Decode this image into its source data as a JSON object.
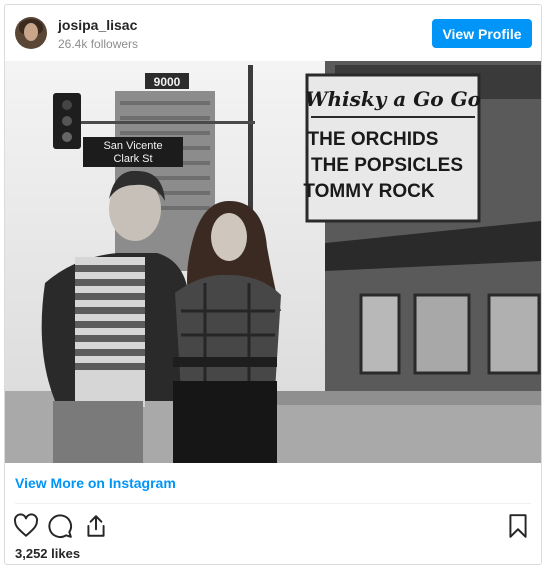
{
  "header": {
    "username": "josipa_lisac",
    "followers": "26.4k followers",
    "view_profile_label": "View Profile"
  },
  "photo": {
    "sign_number": "9000",
    "street_sign_line1": "San Vicente",
    "street_sign_line2": "Clark St",
    "marquee_title": "Whisky a Go Go",
    "marquee_line1": "THE ORCHIDS",
    "marquee_line2": "THE POPSICLES",
    "marquee_line3": "TOMMY ROCK"
  },
  "footer": {
    "view_more_label": "View More on Instagram",
    "likes": "3,252 likes"
  },
  "icons": [
    "heart-icon",
    "comment-icon",
    "share-icon",
    "bookmark-icon"
  ]
}
